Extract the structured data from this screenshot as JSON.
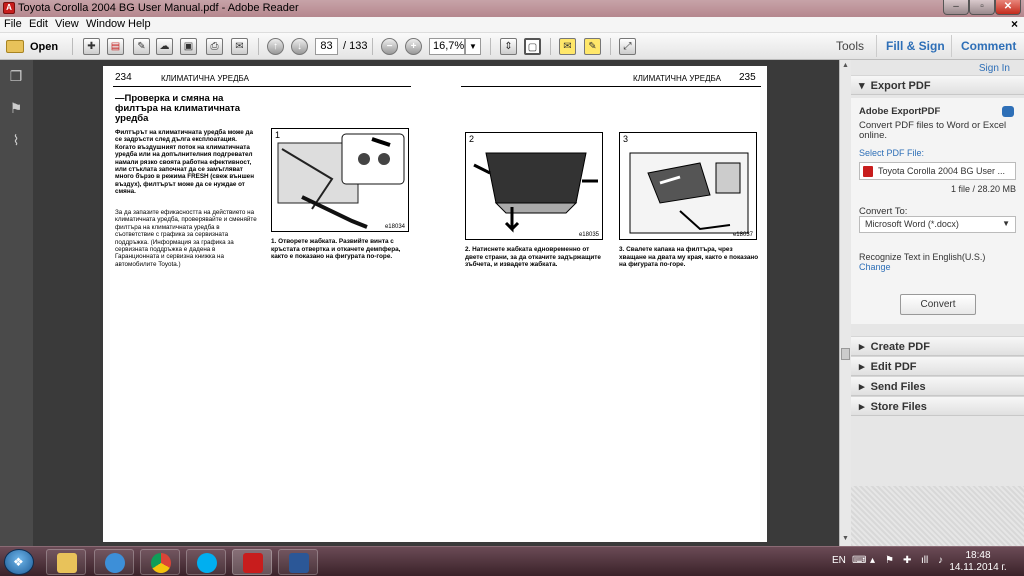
{
  "window": {
    "title": "Toyota Corolla 2004 BG User Manual.pdf - Adobe Reader",
    "min": "–",
    "max": "▫",
    "close": "✕"
  },
  "menu": {
    "items": [
      "File",
      "Edit",
      "View",
      "Window",
      "Help"
    ],
    "close": "×"
  },
  "toolbar": {
    "open_label": "Open",
    "page_current": "83",
    "page_total": "/ 133",
    "zoom": "16,7%",
    "tools": "Tools",
    "fill_sign": "Fill & Sign",
    "comment": "Comment"
  },
  "document": {
    "left_page": {
      "number": "234",
      "header": "КЛИМАТИЧНА УРЕДБА",
      "section_title": "—Проверка и смяна на филтъра на климатичната уредба",
      "bold_paragraph": "Филтърът на климатичната уредба може да се задръсти след дълга експлоатация. Когато въздушният поток на климатичната уредба или на допълнителния подгревател намали рязко своята работна ефективност, или стъклата започнат да се замъгляват много бързо в режима FRESH (свеж външен въздух), филтърът може да се нуждае от смяна.",
      "paragraph": "За да запазите ефикасността на действието на климатичната уредба, проверявайте и сменяйте филтъра на климатичната уредба в съответствие с графика за сервизната поддръжка. (Информация за графика за сервизната поддръжка е дадена в Гаранционната и сервизна книжка на автомобилите Toyota.)",
      "fig1_num": "1",
      "fig1_code": "e18034",
      "fig1_caption": "1. Отворете жабката. Развийте винта с кръстата отвертка и откачете демпфера, както е показано на фигурата по-горе."
    },
    "right_page": {
      "number": "235",
      "header": "КЛИМАТИЧНА УРЕДБА",
      "fig2_num": "2",
      "fig2_code": "e18035",
      "fig2_caption": "2. Натиснете жабката едновременно от двете страни, за да откачите задържащите зъбчета, и извадете жабката.",
      "fig3_num": "3",
      "fig3_code": "e18037",
      "fig3_caption": "3. Свалете капака на филтъра, чрез хващане на двата му края, както е показано на фигурата по-горе."
    }
  },
  "right_panel": {
    "sign_in": "Sign In",
    "export_pdf": "Export PDF",
    "service_name": "Adobe ExportPDF",
    "service_desc_1": "Convert PDF files to Word or Excel",
    "service_desc_2": "online.",
    "select_label": "Select PDF File:",
    "file_name": "Toyota Corolla 2004 BG User ...",
    "file_info": "1 file / 28.20 MB",
    "convert_to_label": "Convert To:",
    "convert_to_value": "Microsoft Word (*.docx)",
    "recognize": "Recognize Text in English(U.S.)",
    "change": "Change",
    "convert_button": "Convert",
    "sections": [
      "Create PDF",
      "Edit PDF",
      "Send Files",
      "Store Files"
    ]
  },
  "taskbar": {
    "lang": "EN",
    "time": "18:48",
    "date": "14.11.2014 г."
  },
  "colors": {
    "accent": "#2e6fb7",
    "pdf_red": "#c81d1d",
    "taskbar": "#4a2f38"
  }
}
